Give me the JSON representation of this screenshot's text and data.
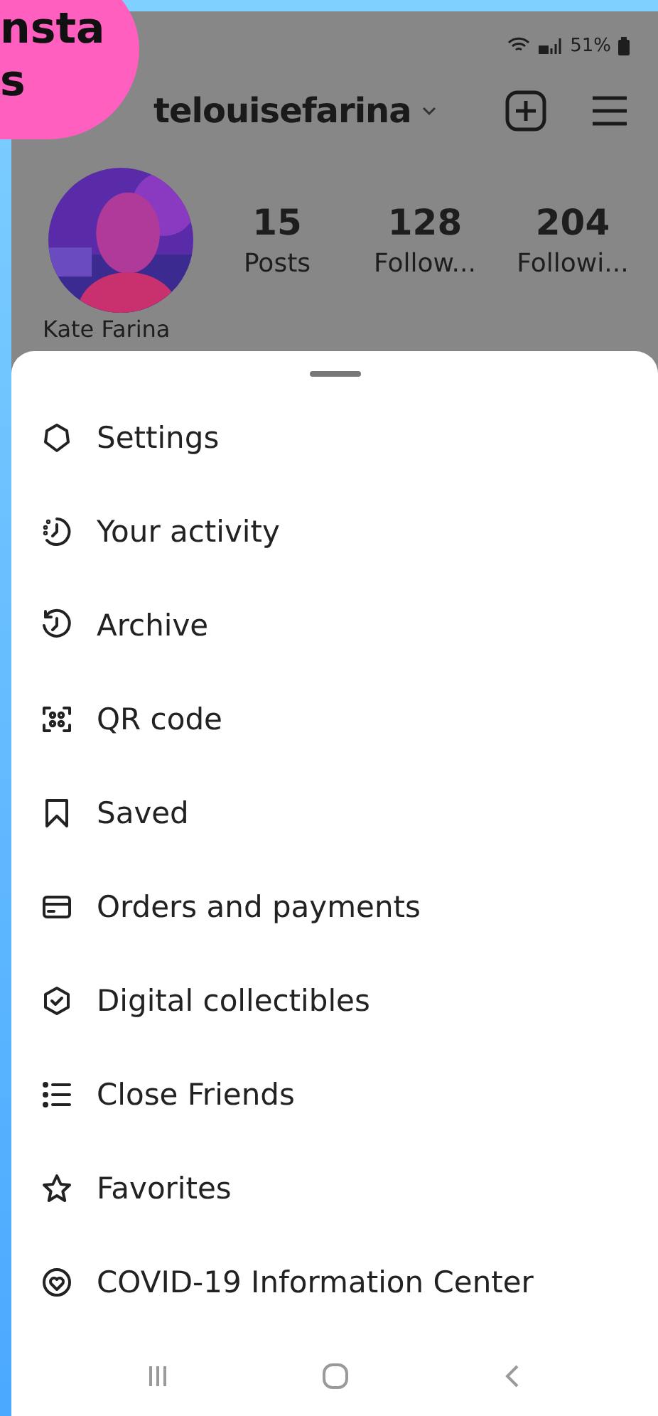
{
  "overlay_label": {
    "lines": [
      "nsta",
      "s"
    ]
  },
  "status_bar": {
    "battery": "51%"
  },
  "profile": {
    "username": "telouisefarina",
    "name": "Kate Farina",
    "stats": [
      {
        "value": "15",
        "label": "Posts"
      },
      {
        "value": "128",
        "label": "Follow..."
      },
      {
        "value": "204",
        "label": "Followi..."
      }
    ]
  },
  "menu": [
    {
      "kind": "settings",
      "label": "Settings"
    },
    {
      "kind": "activity",
      "label": "Your activity"
    },
    {
      "kind": "archive",
      "label": "Archive"
    },
    {
      "kind": "qr",
      "label": "QR code"
    },
    {
      "kind": "saved",
      "label": "Saved"
    },
    {
      "kind": "orders",
      "label": "Orders and payments"
    },
    {
      "kind": "collectibles",
      "label": "Digital collectibles"
    },
    {
      "kind": "friends",
      "label": "Close Friends"
    },
    {
      "kind": "favorites",
      "label": "Favorites"
    },
    {
      "kind": "covid",
      "label": "COVID-19 Information Center"
    }
  ],
  "nav_bar": [
    {
      "kind": "recents"
    },
    {
      "kind": "home"
    },
    {
      "kind": "back"
    }
  ]
}
